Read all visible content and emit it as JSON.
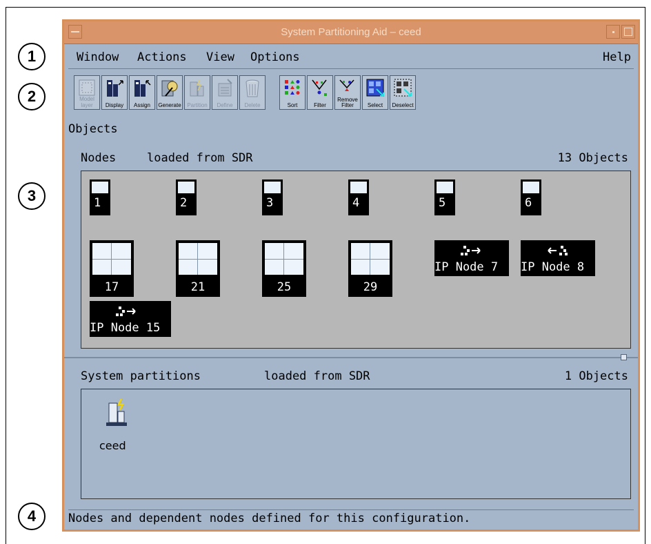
{
  "callouts": [
    "1",
    "2",
    "3",
    "4"
  ],
  "window": {
    "title": "System Partitioning Aid – ceed"
  },
  "menubar": {
    "items": [
      "Window",
      "Actions",
      "View",
      "Options"
    ],
    "help": "Help"
  },
  "toolbar": {
    "buttons": [
      {
        "label": "Model layer",
        "icon": "model-icon",
        "enabled": false
      },
      {
        "label": "Display",
        "icon": "display-icon",
        "enabled": true
      },
      {
        "label": "Assign",
        "icon": "assign-icon",
        "enabled": true
      },
      {
        "label": "Generate",
        "icon": "generate-icon",
        "enabled": true
      },
      {
        "label": "Partition",
        "icon": "partition-icon",
        "enabled": false
      },
      {
        "label": "Define",
        "icon": "define-icon",
        "enabled": false
      },
      {
        "label": "Delete",
        "icon": "trash-icon",
        "enabled": false
      },
      {
        "label": "Sort",
        "icon": "sort-icon",
        "enabled": true
      },
      {
        "label": "Filter",
        "icon": "filter-icon",
        "enabled": true
      },
      {
        "label": "Remove Filter",
        "icon": "remove-filter-icon",
        "enabled": true
      },
      {
        "label": "Select",
        "icon": "select-icon",
        "enabled": true
      },
      {
        "label": "Deselect",
        "icon": "deselect-icon",
        "enabled": true
      }
    ]
  },
  "objects_label": "Objects",
  "nodes": {
    "title": "Nodes",
    "source": "loaded from SDR",
    "count": "13 Objects",
    "small": [
      "1",
      "2",
      "3",
      "4",
      "5",
      "6"
    ],
    "big": [
      "17",
      "21",
      "25",
      "29"
    ],
    "ip": [
      "IP Node 7",
      "IP Node 8",
      "IP Node 15"
    ]
  },
  "partitions": {
    "title": "System partitions",
    "source": "loaded from SDR",
    "count": "1 Objects",
    "items": [
      {
        "label": "ceed",
        "icon": "partition-icon"
      }
    ]
  },
  "status": {
    "text": "Nodes and dependent nodes defined for this configuration."
  },
  "colors": {
    "window_bg": "#a5b6cb",
    "titlebar": "#d9946a",
    "node_bg": "#000000",
    "panel_bg": "#b7b7b7"
  }
}
